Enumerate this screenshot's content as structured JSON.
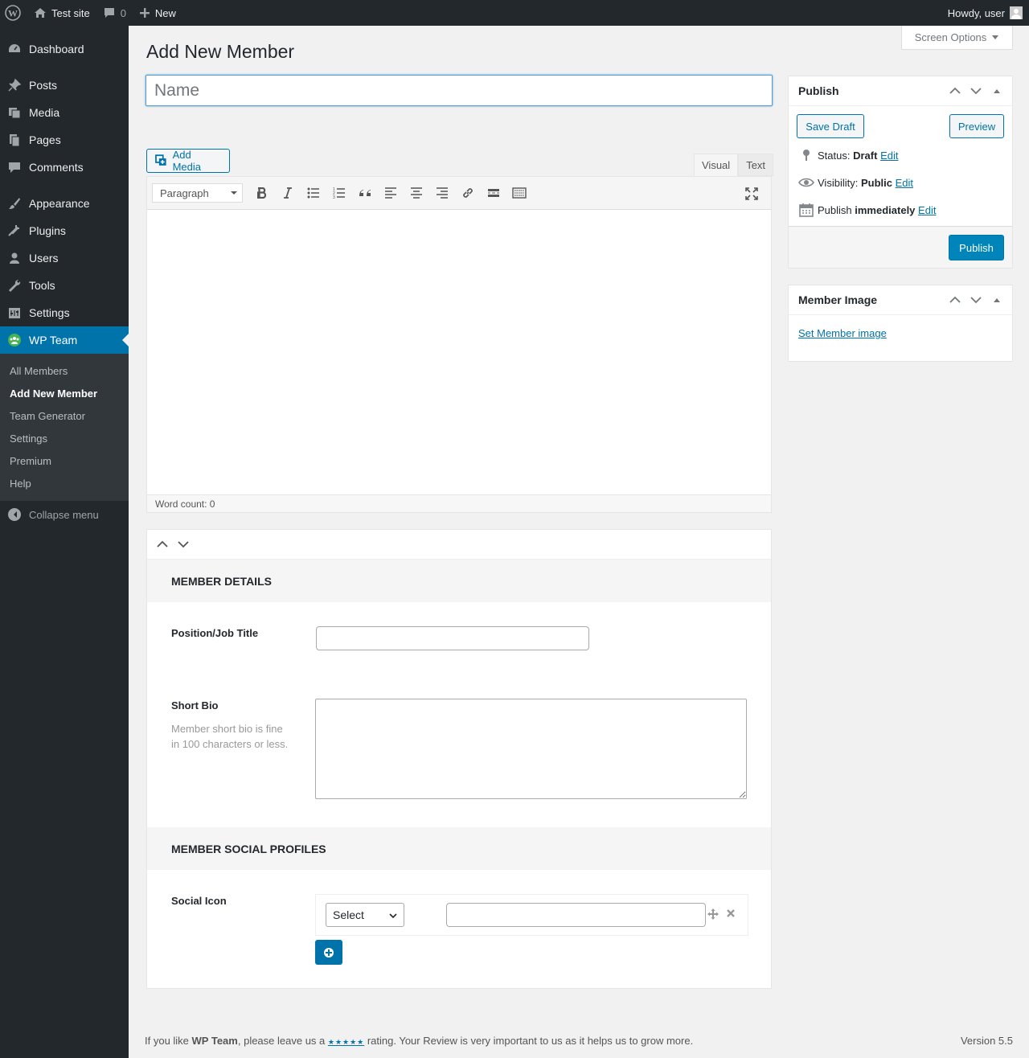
{
  "admin_bar": {
    "site_name": "Test site",
    "comments_count": "0",
    "new_label": "New",
    "howdy": "Howdy, user"
  },
  "sidebar": {
    "items": [
      {
        "label": "Dashboard",
        "icon": "dashboard-icon"
      },
      {
        "label": "Posts",
        "icon": "pin-icon"
      },
      {
        "label": "Media",
        "icon": "media-icon"
      },
      {
        "label": "Pages",
        "icon": "pages-icon"
      },
      {
        "label": "Comments",
        "icon": "comment-icon"
      },
      {
        "label": "Appearance",
        "icon": "brush-icon"
      },
      {
        "label": "Plugins",
        "icon": "plug-icon"
      },
      {
        "label": "Users",
        "icon": "user-icon"
      },
      {
        "label": "Tools",
        "icon": "wrench-icon"
      },
      {
        "label": "Settings",
        "icon": "settings-icon"
      },
      {
        "label": "WP Team",
        "icon": "team-icon"
      }
    ],
    "submenu": [
      "All Members",
      "Add New Member",
      "Team Generator",
      "Settings",
      "Premium",
      "Help"
    ],
    "collapse_label": "Collapse menu"
  },
  "screen_options": "Screen Options",
  "page_title": "Add New Member",
  "title_placeholder": "Name",
  "editor": {
    "add_media": "Add Media",
    "tab_visual": "Visual",
    "tab_text": "Text",
    "format": "Paragraph",
    "word_count": "Word count: 0"
  },
  "member_details": {
    "section_title": "MEMBER DETAILS",
    "position_label": "Position/Job Title",
    "position_value": "",
    "bio_label": "Short Bio",
    "bio_desc": "Member short bio is fine in 100 characters or less.",
    "bio_value": ""
  },
  "social": {
    "section_title": "MEMBER SOCIAL PROFILES",
    "icon_label": "Social Icon",
    "select_value": "Select",
    "url_value": ""
  },
  "publish": {
    "title": "Publish",
    "save_draft": "Save Draft",
    "preview": "Preview",
    "status_label": "Status:",
    "status_value": "Draft",
    "visibility_label": "Visibility:",
    "visibility_value": "Public",
    "publish_label": "Publish",
    "publish_value": "immediately",
    "edit": "Edit",
    "publish_button": "Publish"
  },
  "member_image": {
    "title": "Member Image",
    "link": "Set Member image"
  },
  "footer": {
    "text_before": "If you like ",
    "brand": "WP Team",
    "text_mid": ", please leave us a ",
    "stars": "★★★★★",
    "text_after": " rating. Your Review is very important to us as it helps us to grow more.",
    "version": "Version 5.5"
  }
}
